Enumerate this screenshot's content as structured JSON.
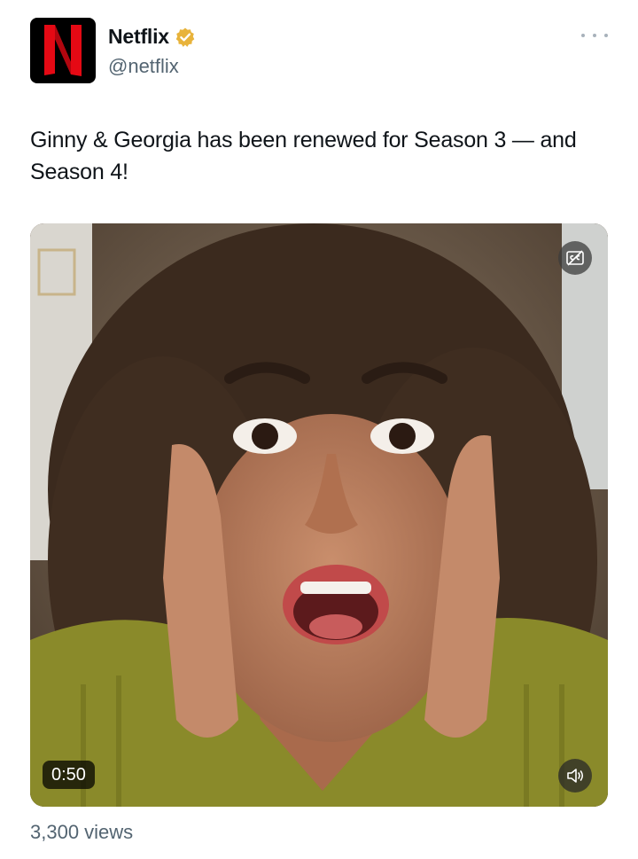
{
  "author": {
    "display_name": "Netflix",
    "handle": "@netflix",
    "avatar_letter": "N",
    "verified": true,
    "verified_color": "#e8b33b",
    "avatar_bg": "#000000",
    "avatar_letter_color": "#e50914"
  },
  "header": {
    "more_icon": "more-horizontal-icon"
  },
  "tweet": {
    "text": "Ginny & Georgia has been renewed for Season 3 — and Season 4!"
  },
  "media": {
    "type": "video",
    "duration": "0:50",
    "captions_icon": "closed-captions-icon",
    "volume_icon": "volume-icon"
  },
  "stats": {
    "views": "3,300 views"
  }
}
